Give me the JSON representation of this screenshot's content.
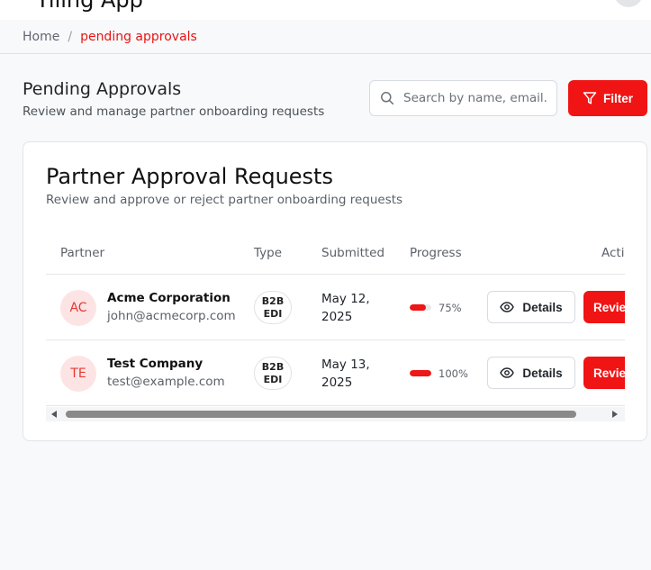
{
  "app": {
    "title": "Tiling App"
  },
  "breadcrumb": {
    "home": "Home",
    "separator": "/",
    "current": "pending approvals"
  },
  "header": {
    "title": "Pending Approvals",
    "subtitle": "Review and manage partner onboarding requests",
    "search_placeholder": "Search by name, email...",
    "filter_label": "Filter"
  },
  "card": {
    "title": "Partner Approval Requests",
    "subtitle": "Review and approve or reject partner onboarding requests",
    "columns": {
      "partner": "Partner",
      "type": "Type",
      "submitted": "Submitted",
      "progress": "Progress",
      "actions": "Actions"
    },
    "rows": [
      {
        "initials": "AC",
        "name": "Acme Corporation",
        "email": "john@acmecorp.com",
        "type_line1": "B2B",
        "type_line2": "EDI",
        "submitted_line1": "May 12,",
        "submitted_line2": "2025",
        "progress": 75,
        "progress_label": "75%",
        "details_label": "Details",
        "review_label": "Review"
      },
      {
        "initials": "TE",
        "name": "Test Company",
        "email": "test@example.com",
        "type_line1": "B2B",
        "type_line2": "EDI",
        "submitted_line1": "May 13,",
        "submitted_line2": "2025",
        "progress": 100,
        "progress_label": "100%",
        "details_label": "Details",
        "review_label": "Review"
      }
    ]
  },
  "colors": {
    "accent": "#f01414",
    "avatar_bg": "#fde4e4",
    "avatar_text": "#e53935"
  },
  "icons": {
    "search": "search-icon",
    "filter": "filter-icon",
    "details": "eye-icon"
  }
}
